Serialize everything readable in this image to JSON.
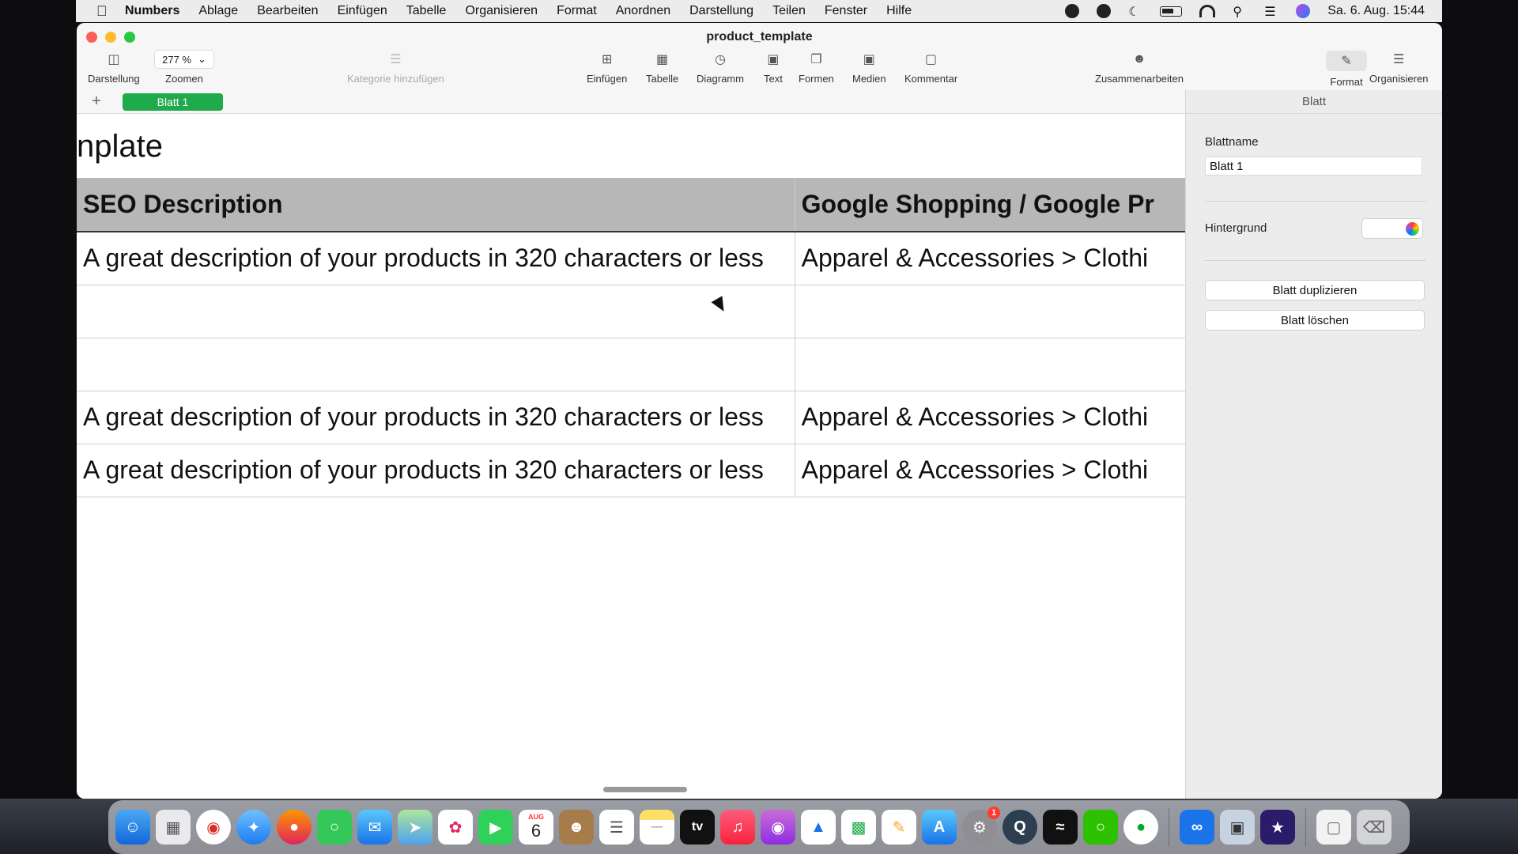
{
  "menubar": {
    "app_name": "Numbers",
    "items": [
      "Ablage",
      "Bearbeiten",
      "Einfügen",
      "Tabelle",
      "Organisieren",
      "Format",
      "Anordnen",
      "Darstellung",
      "Teilen",
      "Fenster",
      "Hilfe"
    ],
    "datetime": "Sa. 6. Aug.  15:44"
  },
  "window": {
    "title": "product_template"
  },
  "toolbar": {
    "darstellung": "Darstellung",
    "zoom_value": "277 %",
    "zoom_label": "Zoomen",
    "category": "Kategorie hinzufügen",
    "insert": "Einfügen",
    "table": "Tabelle",
    "chart": "Diagramm",
    "text": "Text",
    "shapes": "Formen",
    "media": "Medien",
    "comment": "Kommentar",
    "collaborate": "Zusammenarbeiten",
    "format": "Format",
    "organize": "Organisieren"
  },
  "tabs": {
    "add": "+",
    "active_sheet": "Blatt 1"
  },
  "canvas": {
    "heading": "nplate",
    "columns": [
      "SEO Description",
      "Google Shopping / Google Pr"
    ],
    "rows": [
      [
        "A great description of your products in 320 characters or less",
        "Apparel & Accessories > Clothi"
      ],
      [
        "",
        ""
      ],
      [
        "",
        ""
      ],
      [
        "A great description of your products in 320 characters or less",
        "Apparel & Accessories > Clothi"
      ],
      [
        "A great description of your products in 320 characters or less",
        "Apparel & Accessories > Clothi"
      ]
    ]
  },
  "inspector": {
    "title": "Blatt",
    "name_label": "Blattname",
    "name_value": "Blatt 1",
    "background_label": "Hintergrund",
    "duplicate_button": "Blatt duplizieren",
    "delete_button": "Blatt löschen"
  },
  "dock": {
    "calendar_month": "AUG",
    "calendar_day": "6",
    "tv_label": "tv",
    "settings_badge": "1"
  },
  "colors": {
    "sheet_tab": "#1faa4b",
    "header_row": "#b7b7b7"
  }
}
